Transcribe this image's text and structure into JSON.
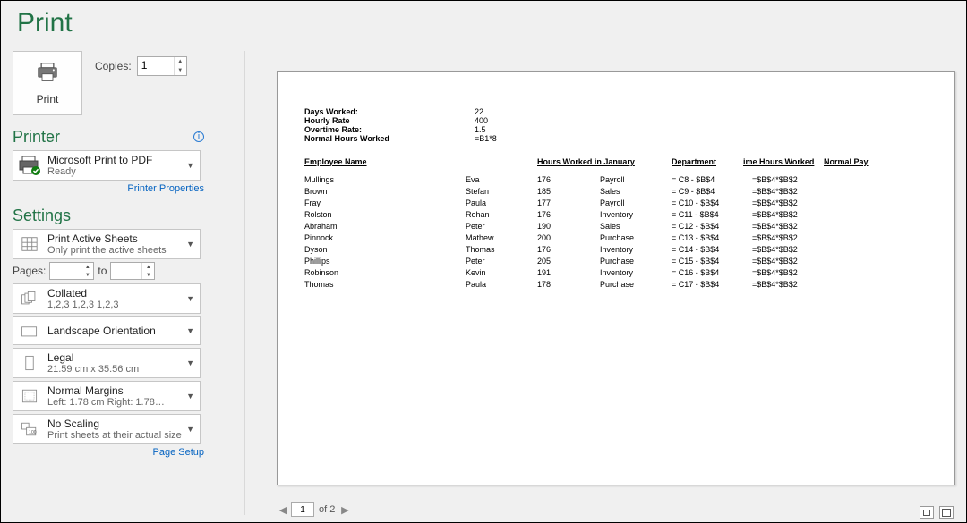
{
  "title": "Print",
  "print_button_label": "Print",
  "copies": {
    "label": "Copies:",
    "value": "1"
  },
  "printer": {
    "section_label": "Printer",
    "name": "Microsoft Print to PDF",
    "status": "Ready",
    "properties_link": "Printer Properties"
  },
  "settings": {
    "section_label": "Settings",
    "print_what": {
      "line1": "Print Active Sheets",
      "line2": "Only print the active sheets"
    },
    "pages": {
      "label": "Pages:",
      "to": "to",
      "from": "",
      "to_val": ""
    },
    "collated": {
      "line1": "Collated",
      "line2": "1,2,3    1,2,3    1,2,3"
    },
    "orientation": {
      "line1": "Landscape Orientation"
    },
    "paper": {
      "line1": "Legal",
      "line2": "21.59 cm x 35.56 cm"
    },
    "margins": {
      "line1": "Normal Margins",
      "line2": "Left:  1.78 cm    Right:  1.78…"
    },
    "scaling": {
      "line1": "No Scaling",
      "line2": "Print sheets at their actual size"
    },
    "page_setup_link": "Page Setup"
  },
  "nav": {
    "page": "1",
    "of": "of 2"
  },
  "sheet": {
    "kv": [
      {
        "label": "Days Worked:",
        "value": "22"
      },
      {
        "label": "Hourly Rate",
        "value": "400"
      },
      {
        "label": "Overtime Rate:",
        "value": "1.5"
      },
      {
        "label": "Normal Hours Worked",
        "value": "=B1*8"
      }
    ],
    "headers": {
      "c1": "Employee Name",
      "c3": "Hours Worked in January",
      "c4": "Department",
      "c5": "ime Hours Worked",
      "c6": "Normal Pay"
    },
    "rows": [
      {
        "c1": "Mullings",
        "c2": "Eva",
        "c3": "176",
        "c4": "Payroll",
        "c5": "= C8 - $B$4",
        "c6": "=$B$4*$B$2"
      },
      {
        "c1": "Brown",
        "c2": "Stefan",
        "c3": "185",
        "c4": "Sales",
        "c5": "= C9 - $B$4",
        "c6": "=$B$4*$B$2"
      },
      {
        "c1": "Fray",
        "c2": "Paula",
        "c3": "177",
        "c4": "Payroll",
        "c5": "= C10 - $B$4",
        "c6": "=$B$4*$B$2"
      },
      {
        "c1": "Rolston",
        "c2": "Rohan",
        "c3": "176",
        "c4": "Inventory",
        "c5": "= C11 - $B$4",
        "c6": "=$B$4*$B$2"
      },
      {
        "c1": "Abraham",
        "c2": "Peter",
        "c3": "190",
        "c4": "Sales",
        "c5": "= C12 - $B$4",
        "c6": "=$B$4*$B$2"
      },
      {
        "c1": "Pinnock",
        "c2": "Mathew",
        "c3": "200",
        "c4": "Purchase",
        "c5": "= C13 - $B$4",
        "c6": "=$B$4*$B$2"
      },
      {
        "c1": "Dyson",
        "c2": "Thomas",
        "c3": "176",
        "c4": "Inventory",
        "c5": "= C14 - $B$4",
        "c6": "=$B$4*$B$2"
      },
      {
        "c1": "Phillips",
        "c2": "Peter",
        "c3": "205",
        "c4": "Purchase",
        "c5": "= C15 - $B$4",
        "c6": "=$B$4*$B$2"
      },
      {
        "c1": "Robinson",
        "c2": "Kevin",
        "c3": "191",
        "c4": "Inventory",
        "c5": "= C16 - $B$4",
        "c6": "=$B$4*$B$2"
      },
      {
        "c1": "Thomas",
        "c2": "Paula",
        "c3": "178",
        "c4": "Purchase",
        "c5": "= C17 - $B$4",
        "c6": "=$B$4*$B$2"
      }
    ]
  }
}
